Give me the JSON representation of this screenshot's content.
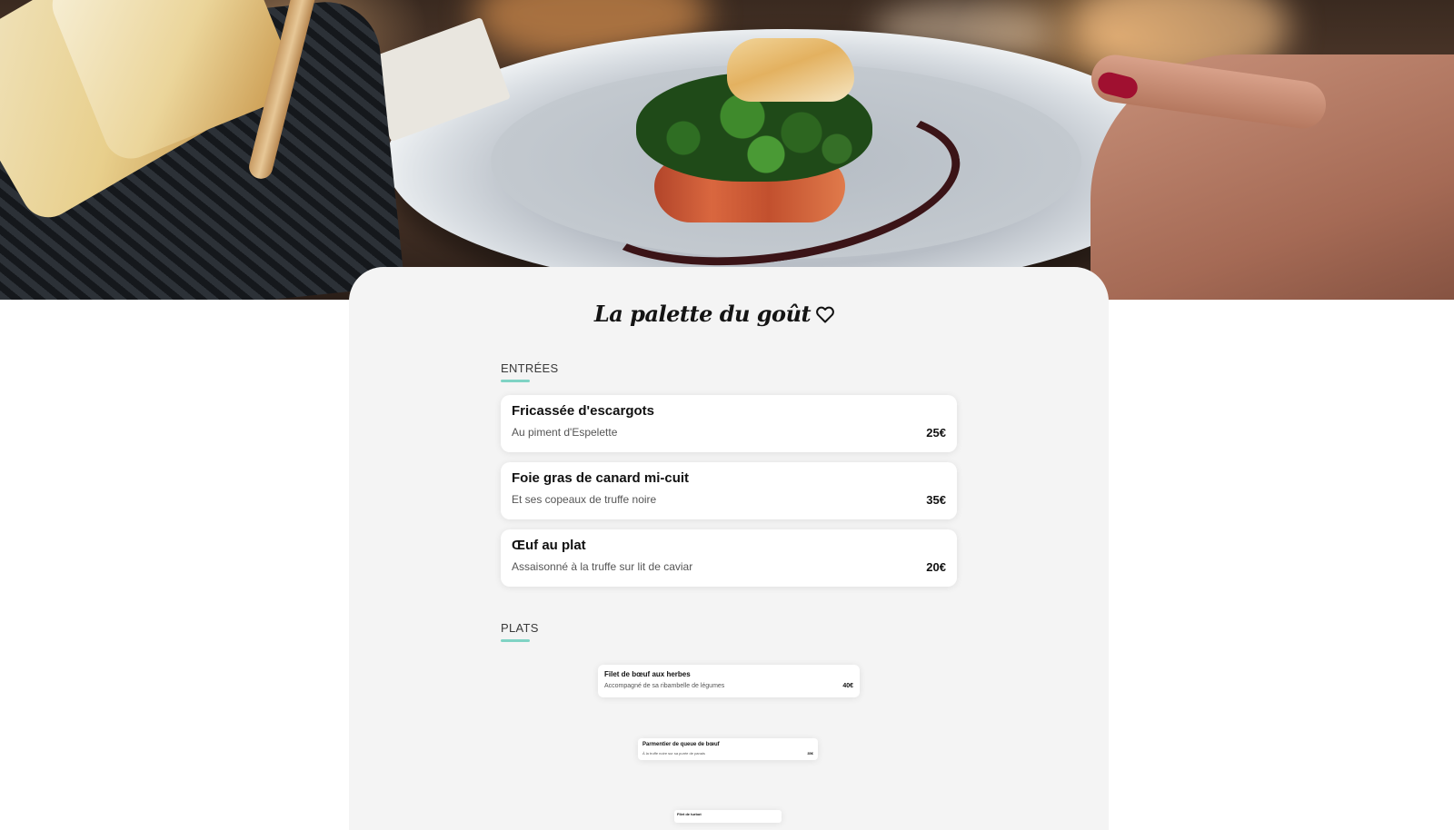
{
  "header": {
    "title": "La palette du goût",
    "favorite_icon": "heart-outline-icon"
  },
  "sections": [
    {
      "label": "ENTRÉES",
      "items": [
        {
          "name": "Fricassée d'escargots",
          "description": "Au piment d'Espelette",
          "price": "25€"
        },
        {
          "name": "Foie gras de canard mi-cuit",
          "description": "Et ses copeaux de truffe noire",
          "price": "35€"
        },
        {
          "name": "Œuf au plat",
          "description": "Assaisonné à la truffe sur lit de caviar",
          "price": "20€"
        }
      ]
    },
    {
      "label": "PLATS",
      "items": [
        {
          "name": "Filet de bœuf aux herbes",
          "description": "Accompagné de sa ribambelle de légumes",
          "price": "40€"
        },
        {
          "name": "Parmentier de queue de bœuf",
          "description": "À la truffe noire sur sa purée de panais",
          "price": "35€"
        },
        {
          "name": "Filet de turbot"
        }
      ]
    }
  ],
  "colors": {
    "accent": "#7fd3c4",
    "sheet_background": "#f4f4f4",
    "card_background": "#ffffff"
  }
}
